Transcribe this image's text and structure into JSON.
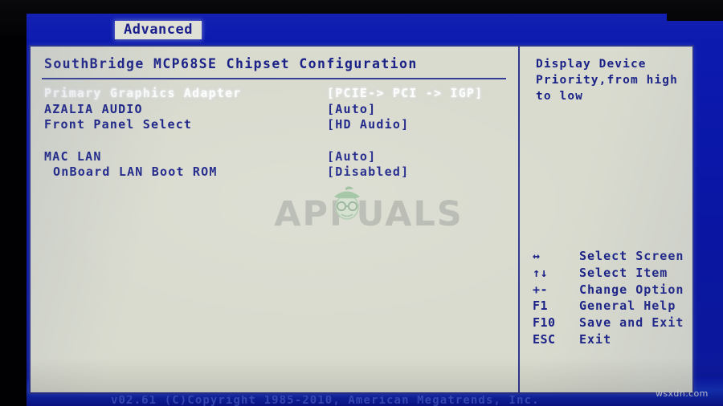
{
  "menubar": {
    "active_tab": "Advanced"
  },
  "window": {
    "section_title": "SouthBridge MCP68SE Chipset Configuration"
  },
  "settings": {
    "groups": [
      {
        "rows": [
          {
            "label": "Primary Graphics Adapter",
            "value": "[PCIE-> PCI  -> IGP]",
            "selected": true,
            "indent": false
          },
          {
            "label": "AZALIA AUDIO",
            "value": "[Auto]",
            "selected": false,
            "indent": false
          },
          {
            "label": "Front Panel Select",
            "value": "[HD Audio]",
            "selected": false,
            "indent": false
          }
        ]
      },
      {
        "rows": [
          {
            "label": "MAC LAN",
            "value": "[Auto]",
            "selected": false,
            "indent": false
          },
          {
            "label": "OnBoard LAN Boot ROM",
            "value": "[Disabled]",
            "selected": false,
            "indent": true
          }
        ]
      }
    ]
  },
  "help": {
    "text": "Display Device Priority,from high to low",
    "keys": [
      {
        "symbol": "↔",
        "description": "Select Screen"
      },
      {
        "symbol": "↑↓",
        "description": "Select Item"
      },
      {
        "symbol": "+-",
        "description": "Change Option"
      },
      {
        "symbol": "F1",
        "description": "General Help"
      },
      {
        "symbol": "F10",
        "description": "Save and Exit"
      },
      {
        "symbol": "ESC",
        "description": "Exit"
      }
    ]
  },
  "footer": {
    "copyright": "v02.61 (C)Copyright 1985-2010, American Megatrends, Inc."
  },
  "watermarks": {
    "center": "APPUALS",
    "corner": "wsxdn.com"
  },
  "colors": {
    "desktop_blue": "#0a17a8",
    "panel_bg": "#d9dbcf",
    "text_blue": "#1b2287",
    "selected_text": "#fdfdfd",
    "border_blue": "#2b3391"
  }
}
